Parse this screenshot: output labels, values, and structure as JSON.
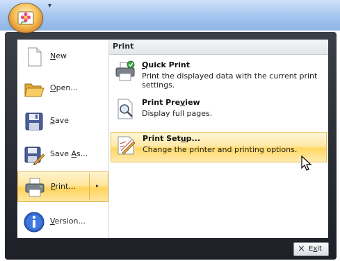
{
  "qat": {
    "customize_arrow": "▾"
  },
  "left_menu": {
    "items": [
      {
        "id": "new",
        "mnemonic": "N",
        "rest": "ew"
      },
      {
        "id": "open",
        "mnemonic": "O",
        "rest": "pen..."
      },
      {
        "id": "save",
        "mnemonic": "S",
        "rest": "ave"
      },
      {
        "id": "save-as",
        "before": "Save ",
        "mnemonic": "A",
        "rest": "s..."
      },
      {
        "id": "print",
        "mnemonic": "P",
        "rest": "rint...",
        "active": true
      },
      {
        "id": "version",
        "mnemonic": "V",
        "rest": "ersion..."
      }
    ],
    "print_split_arrow": "▸"
  },
  "right_panel": {
    "header": "Print",
    "items": [
      {
        "id": "quick-print",
        "title_mnemonic": "Q",
        "title_rest": "uick Print",
        "description": "Print the displayed data with the current print settings."
      },
      {
        "id": "print-preview",
        "title_before": "Print Pre",
        "title_mnemonic": "v",
        "title_rest": "iew",
        "description": "Display full pages."
      },
      {
        "id": "print-setup",
        "title_before": "Print Set",
        "title_mnemonic": "u",
        "title_rest": "p...",
        "description": "Change the printer and printing options.",
        "active": true
      }
    ]
  },
  "exit_button": {
    "before": "E",
    "mnemonic": "x",
    "rest": "it",
    "icon": "×"
  },
  "colors": {
    "highlight": "#ffd863",
    "menu_frame": "#2a2d33",
    "titlebar": "#a9c9f0"
  }
}
